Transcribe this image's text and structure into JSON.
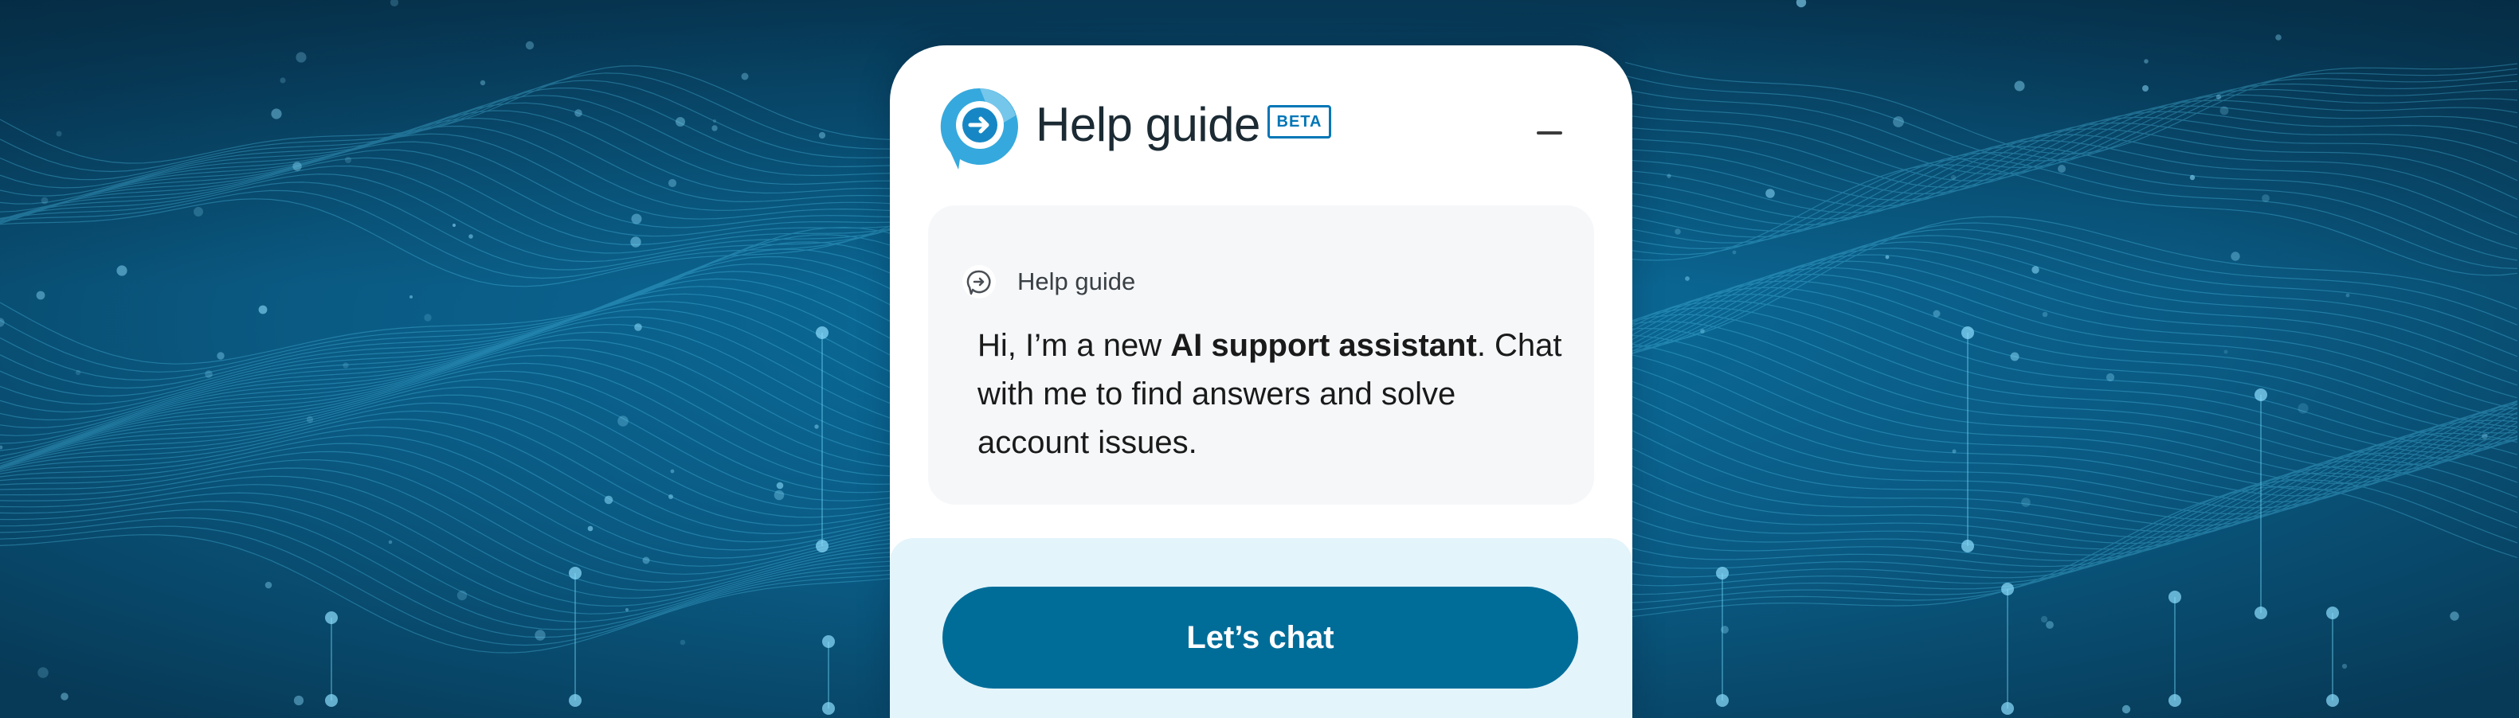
{
  "widget": {
    "title": "Help guide",
    "badge": "BETA",
    "logo_icon": "chat-arrow-logo-icon",
    "minimize_icon": "minimize-icon"
  },
  "message_card": {
    "sender": "Help guide",
    "sender_icon": "chat-arrow-icon",
    "text_before": "Hi, I’m a new ",
    "text_bold": "AI support assistant",
    "text_after": ". Chat with me to find answers and solve account issues."
  },
  "actions": {
    "chat_button_label": "Let’s chat"
  },
  "colors": {
    "accent": "#0076b6",
    "button": "#006d99",
    "footer_bg": "#e3f4fb",
    "card_bg": "#f5f7f9",
    "background": "#0b4f73"
  }
}
